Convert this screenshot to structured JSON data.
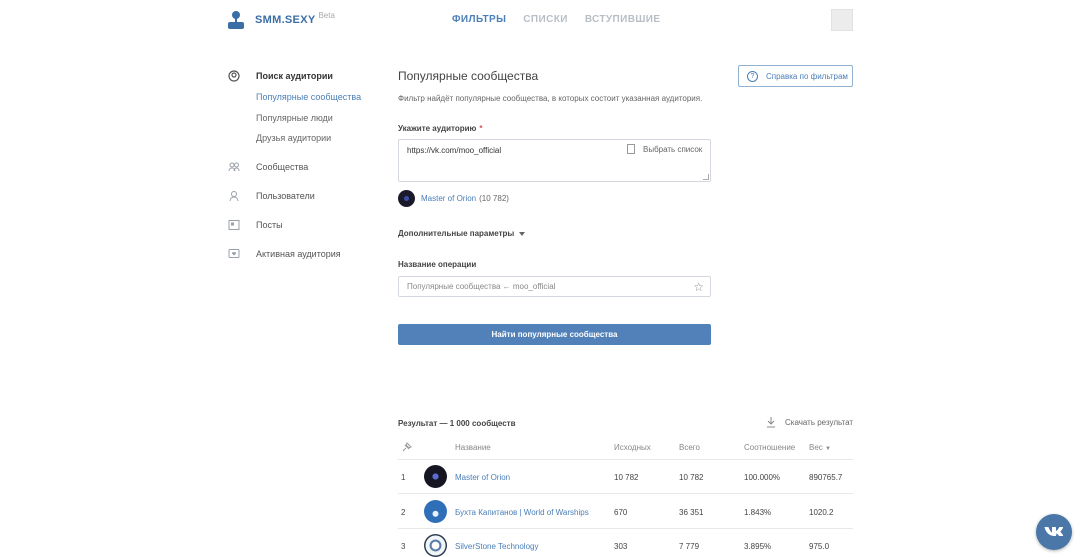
{
  "brand": {
    "name": "SMM.SEXY",
    "beta": "Beta"
  },
  "nav": [
    {
      "label": "ФИЛЬТРЫ",
      "active": true
    },
    {
      "label": "СПИСКИ",
      "active": false
    },
    {
      "label": "ВСТУПИВШИЕ",
      "active": false
    }
  ],
  "sidebar": {
    "search_audience": "Поиск аудитории",
    "sub_items": [
      "Популярные сообщества",
      "Популярные люди",
      "Друзья аудитории"
    ],
    "communities": "Сообщества",
    "users": "Пользователи",
    "posts": "Посты",
    "active_audience": "Активная аудитория"
  },
  "main": {
    "title": "Популярные сообщества",
    "description": "Фильтр найдёт популярные сообщества, в которых состоит указанная аудитория.",
    "help_button": "Справка по фильтрам",
    "audience_label": "Укажите аудиторию",
    "required_mark": "*",
    "audience_value": "https://vk.com/moo_official",
    "pick_list": "Выбрать список",
    "group_name": "Master of Orion",
    "group_count": "(10 782)",
    "extra_params": "Дополнительные параметры",
    "operation_label": "Название операции",
    "operation_placeholder": "Популярные сообщества  ←  moo_official",
    "find_button": "Найти популярные сообщества",
    "result_title": "Результат — 1 000 сообществ",
    "download": "Скачать результат"
  },
  "table": {
    "headers": {
      "name": "Название",
      "source": "Исходных",
      "total": "Всего",
      "ratio": "Соотношение",
      "weight": "Вес"
    },
    "rows": [
      {
        "num": "1",
        "name": "Master of Orion",
        "source": "10 782",
        "total": "10 782",
        "ratio": "100.000%",
        "weight": "890765.7"
      },
      {
        "num": "2",
        "name": "Бухта Капитанов | World of Warships",
        "source": "670",
        "total": "36 351",
        "ratio": "1.843%",
        "weight": "1020.2"
      },
      {
        "num": "3",
        "name": "SilverStone Technology",
        "source": "303",
        "total": "7 779",
        "ratio": "3.895%",
        "weight": "975.0"
      }
    ]
  },
  "colors": {
    "accent": "#5181b8",
    "link": "#4a7fb8",
    "vk": "#4a76a8"
  }
}
